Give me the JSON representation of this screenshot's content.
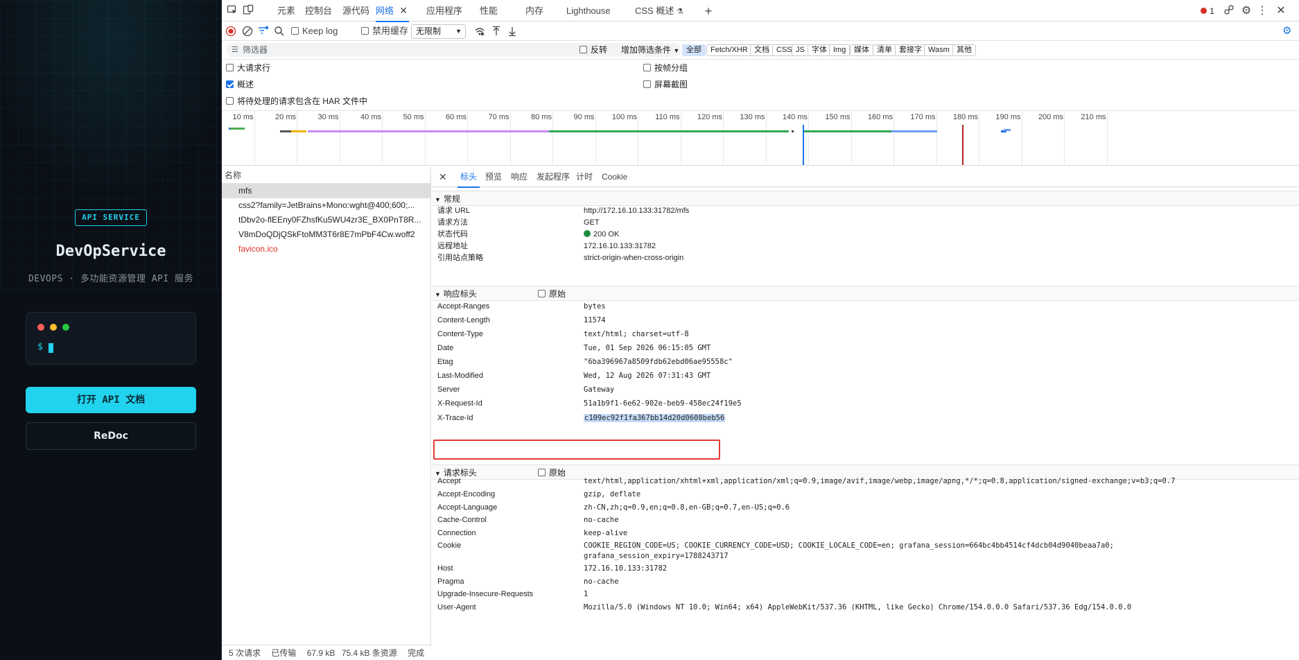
{
  "app": {
    "badge": "API SERVICE",
    "title": "DevOpService",
    "subtitle": "DEVOPS · 多功能资源管理 API 服务",
    "prompt": "$",
    "open_docs_label": "打开 API 文档",
    "redoc_label": "ReDoc",
    "colors": {
      "accent": "#22d3ee",
      "background": "#0b0f16"
    }
  },
  "devtools": {
    "tabs": [
      "元素",
      "控制台",
      "源代码",
      "网络",
      "应用程序",
      "性能",
      "内存",
      "Lighthouse",
      "CSS 概述"
    ],
    "active_tab": "网络",
    "error_count": "1",
    "toolbar": {
      "keep_log": "Keep log",
      "disable_cache": "禁用缓存",
      "throttle": "无限制"
    },
    "filter": {
      "placeholder": "筛选器",
      "invert": "反转",
      "more_filters": "增加筛选条件",
      "chips": [
        "全部",
        "Fetch/XHR",
        "文档",
        "CSS",
        "JS",
        "字体",
        "Img",
        "媒体",
        "清单",
        "套接字",
        "Wasm",
        "其他"
      ]
    },
    "options": {
      "big_rows": "大请求行",
      "overview": "概述",
      "har": "将待处理的请求包含在 HAR 文件中",
      "group_by_frame": "按帧分组",
      "screenshots": "屏幕截图"
    },
    "timeline_ticks": [
      "10 ms",
      "20 ms",
      "30 ms",
      "40 ms",
      "50 ms",
      "60 ms",
      "70 ms",
      "80 ms",
      "90 ms",
      "100 ms",
      "110 ms",
      "120 ms",
      "130 ms",
      "140 ms",
      "150 ms",
      "160 ms",
      "170 ms",
      "180 ms",
      "190 ms",
      "200 ms",
      "210 ms"
    ],
    "requests": {
      "header": "名称",
      "items": [
        {
          "name": "mfs",
          "error": false
        },
        {
          "name": "css2?family=JetBrains+Mono:wght@400;600;...",
          "error": false
        },
        {
          "name": "tDbv2o-flEEny0FZhsfKu5WU4zr3E_BX0PnT8R...",
          "error": false
        },
        {
          "name": "V8mDoQDjQSkFtoMM3T6r8E7mPbF4Cw.woff2",
          "error": false
        },
        {
          "name": "favicon.ico",
          "error": true
        }
      ]
    },
    "status": {
      "requests": "5 次请求",
      "transferred_label": "已传输",
      "transferred": "67.9 kB",
      "resources": "75.4 kB 条资源",
      "finish": "完成"
    },
    "detail_tabs": [
      "标头",
      "预览",
      "响应",
      "发起程序",
      "计时",
      "Cookie"
    ],
    "general": {
      "title": "常规",
      "rows": [
        {
          "k": "请求 URL",
          "v": "http://172.16.10.133:31782/mfs"
        },
        {
          "k": "请求方法",
          "v": "GET"
        },
        {
          "k": "状态代码",
          "v": "200 OK"
        },
        {
          "k": "远程地址",
          "v": "172.16.10.133:31782"
        },
        {
          "k": "引用站点策略",
          "v": "strict-origin-when-cross-origin"
        }
      ]
    },
    "response_headers": {
      "title": "响应标头",
      "raw": "原始",
      "rows": [
        {
          "k": "Accept-Ranges",
          "v": "bytes"
        },
        {
          "k": "Content-Length",
          "v": "11574"
        },
        {
          "k": "Content-Type",
          "v": "text/html; charset=utf-8"
        },
        {
          "k": "Date",
          "v": "Tue, 01 Sep 2026 06:15:05 GMT"
        },
        {
          "k": "Etag",
          "v": "\"6ba396967a8509fdb62ebd06ae95558c\""
        },
        {
          "k": "Last-Modified",
          "v": "Wed, 12 Aug 2026 07:31:43 GMT"
        },
        {
          "k": "Server",
          "v": "Gateway"
        },
        {
          "k": "X-Request-Id",
          "v": "51a1b9f1-6e62-902e-beb9-458ec24f19e5"
        },
        {
          "k": "X-Trace-Id",
          "v": "c109ec92f1fa367bb14d20d0608beb56"
        }
      ]
    },
    "request_headers": {
      "title": "请求标头",
      "raw": "原始",
      "rows": [
        {
          "k": "Accept",
          "v": "text/html,application/xhtml+xml,application/xml;q=0.9,image/avif,image/webp,image/apng,*/*;q=0.8,application/signed-exchange;v=b3;q=0.7"
        },
        {
          "k": "Accept-Encoding",
          "v": "gzip, deflate"
        },
        {
          "k": "Accept-Language",
          "v": "zh-CN,zh;q=0.9,en;q=0.8,en-GB;q=0.7,en-US;q=0.6"
        },
        {
          "k": "Cache-Control",
          "v": "no-cache"
        },
        {
          "k": "Connection",
          "v": "keep-alive"
        },
        {
          "k": "Cookie",
          "v": "COOKIE_REGION_CODE=US; COOKIE_CURRENCY_CODE=USD; COOKIE_LOCALE_CODE=en; grafana_session=664bc4bb4514cf4dcb04d9040beaa7a0;",
          "v2": "grafana_session_expiry=1788243717"
        },
        {
          "k": "Host",
          "v": "172.16.10.133:31782"
        },
        {
          "k": "Pragma",
          "v": "no-cache"
        },
        {
          "k": "Upgrade-Insecure-Requests",
          "v": "1"
        },
        {
          "k": "User-Agent",
          "v": "Mozilla/5.0 (Windows NT 10.0; Win64; x64) AppleWebKit/537.36 (KHTML, like Gecko) Chrome/154.0.0.0 Safari/537.36 Edg/154.0.0.0"
        }
      ]
    }
  }
}
